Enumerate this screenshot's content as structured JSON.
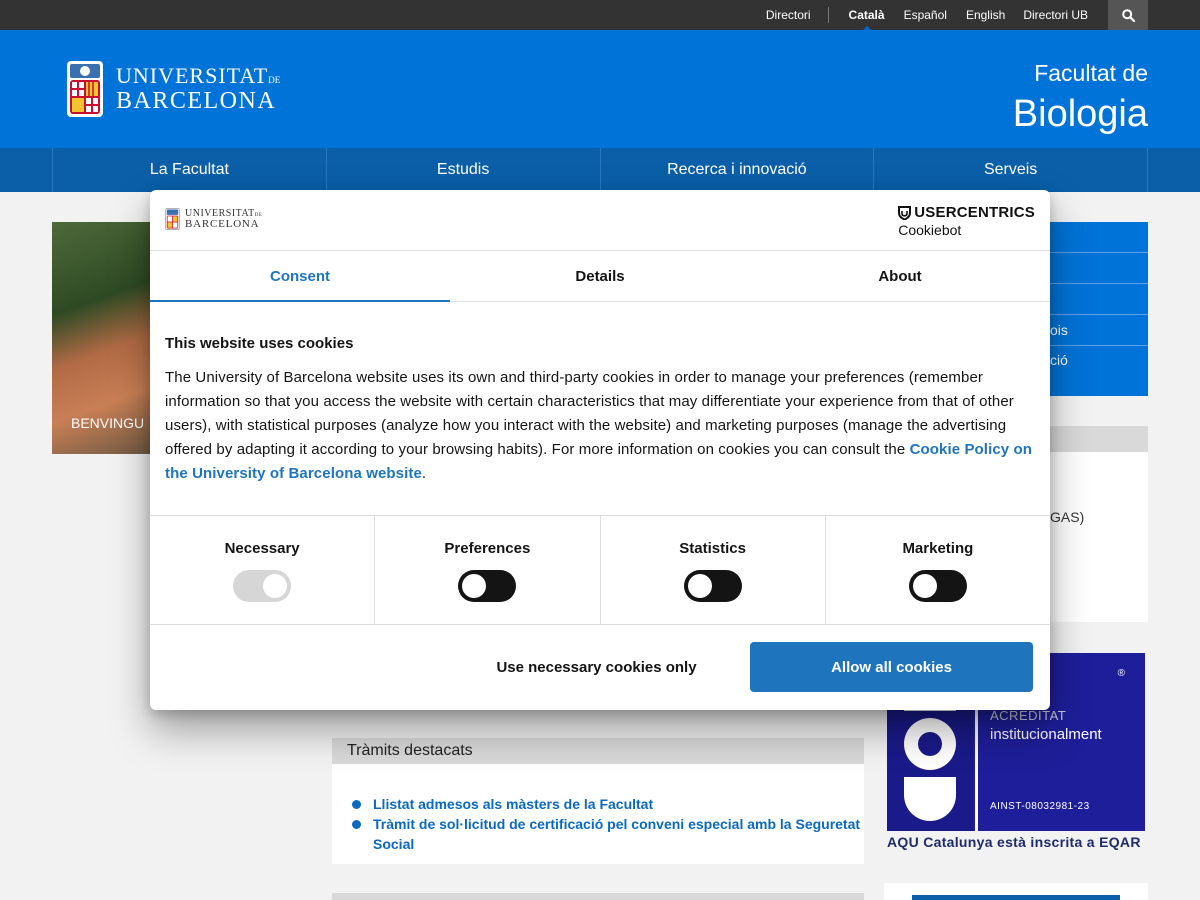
{
  "topbar": {
    "links": [
      "Directori",
      "Català",
      "Español",
      "English",
      "Directori UB"
    ],
    "active": "Català",
    "search_icon": "search-icon"
  },
  "header": {
    "logo_line1": "UNIVERSITAT",
    "logo_line1_small": "DE",
    "logo_line2": "BARCELONA",
    "faculty_line1": "Facultat de",
    "faculty_line2": "Biologia"
  },
  "nav": {
    "items": [
      "La Facultat",
      "Estudis",
      "Recerca i innovació",
      "Serveis"
    ]
  },
  "background": {
    "hero_text": "BENVINGU",
    "side_items": [
      "",
      "",
      "",
      "ois",
      "ció"
    ],
    "side_white_text": "GAS)",
    "tramits": {
      "title": "Tràmits destacats",
      "items": [
        "Llistat admesos als màsters de la Facultat",
        "Tràmit de sol·licitud de certificació pel conveni especial amb la Seguretat Social"
      ]
    },
    "aqu": {
      "registered": "®",
      "line1": "ACREDITAT",
      "line2": "institucionalment",
      "code": "AINST-08032981-23",
      "caption": "AQU Catalunya està inscrita a EQAR"
    }
  },
  "dialog": {
    "logo_line1": "UNIVERSITAT",
    "logo_line1_small": "DE",
    "logo_line2": "BARCELONA",
    "brand_line1": "USERCENTRICS",
    "brand_line2": "Cookiebot",
    "tabs": [
      "Consent",
      "Details",
      "About"
    ],
    "active_tab": "Consent",
    "title": "This website uses cookies",
    "body": "The University of Barcelona website uses its own and third-party cookies in order to manage your preferences (remember information so that you access the website with certain characteristics that may differentiate your experience from that of other users), with statistical purposes (analyze how you interact with the website) and marketing purposes (manage the advertising offered by adapting it according to your browsing habits). For more information on cookies you can consult the ",
    "link": "Cookie Policy on the University of Barcelona website",
    "link_suffix": ".",
    "categories": [
      {
        "label": "Necessary",
        "state": "on-disabled"
      },
      {
        "label": "Preferences",
        "state": "off"
      },
      {
        "label": "Statistics",
        "state": "off"
      },
      {
        "label": "Marketing",
        "state": "off"
      }
    ],
    "btn_necessary": "Use necessary cookies only",
    "btn_allow": "Allow all cookies"
  },
  "colors": {
    "header_blue": "#0073d8",
    "nav_blue": "#0a5fa8",
    "accent": "#1f75bd",
    "aqu_blue": "#1e1e9a"
  }
}
